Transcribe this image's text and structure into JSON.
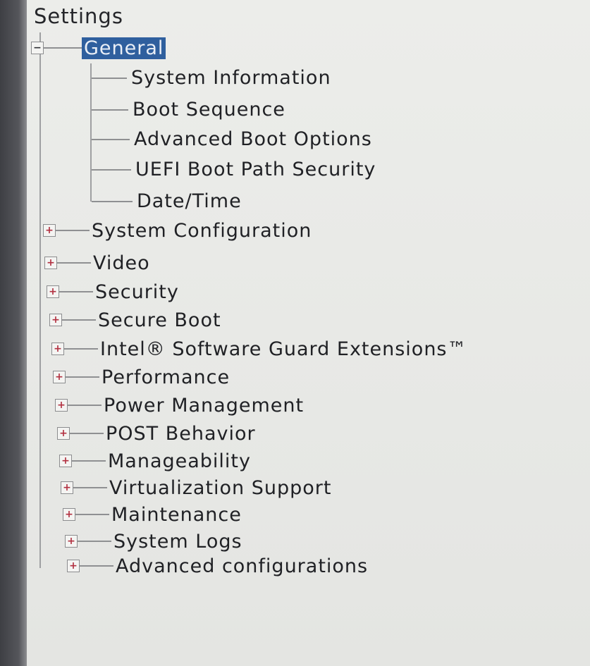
{
  "title": "Settings",
  "tree": {
    "general": {
      "label": "General",
      "expanded": true,
      "selected": true,
      "children": [
        "System Information",
        "Boot Sequence",
        "Advanced Boot Options",
        "UEFI Boot Path Security",
        "Date/Time"
      ]
    },
    "items": [
      "System Configuration",
      "Video",
      "Security",
      "Secure Boot",
      "Intel® Software Guard Extensions™",
      "Performance",
      "Power Management",
      "POST Behavior",
      "Manageability",
      "Virtualization Support",
      "Maintenance",
      "System Logs",
      "Advanced configurations"
    ]
  },
  "colors": {
    "selection": "#2f5f9e",
    "expand_plus": "#b23040",
    "background": "#e9eae7"
  },
  "icons": {
    "collapse": "minus-box-icon",
    "expand": "plus-box-icon"
  }
}
